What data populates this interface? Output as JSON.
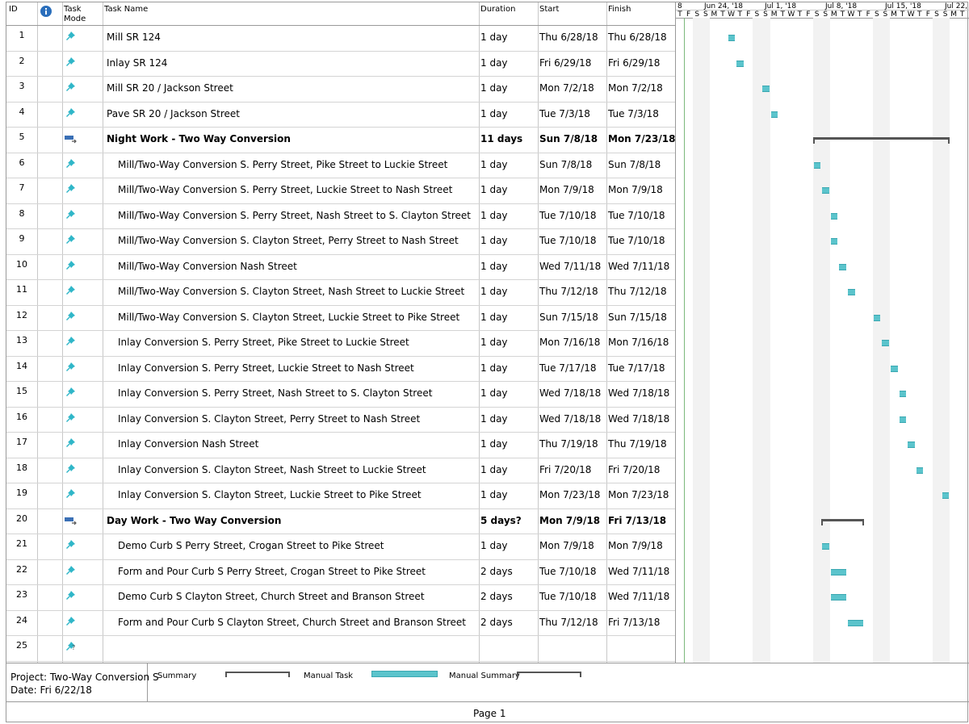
{
  "columns": {
    "id": "ID",
    "task_mode": "Task\nMode",
    "task_name": "Task Name",
    "duration": "Duration",
    "start": "Start",
    "finish": "Finish"
  },
  "timeline": {
    "weeks": [
      "8",
      "Jun 24, '18",
      "Jul 1, '18",
      "Jul 8, '18",
      "Jul 15, '18",
      "Jul 22, '18"
    ],
    "days": [
      "T",
      "F",
      "S",
      "S",
      "M",
      "T",
      "W",
      "T",
      "F",
      "S",
      "S",
      "M",
      "T",
      "W",
      "T",
      "F",
      "S",
      "S",
      "M",
      "T",
      "W",
      "T",
      "F",
      "S",
      "S",
      "M",
      "T",
      "W",
      "T",
      "F",
      "S",
      "S",
      "M",
      "T"
    ]
  },
  "tasks": [
    {
      "id": "1",
      "name": "Mill SR 124",
      "duration": "1 day",
      "start": "Thu 6/28/18",
      "finish": "Thu 6/28/18",
      "indent": 0,
      "summary": false,
      "bar_start": 6,
      "bar_len": 1
    },
    {
      "id": "2",
      "name": "Inlay SR 124",
      "duration": "1 day",
      "start": "Fri 6/29/18",
      "finish": "Fri 6/29/18",
      "indent": 0,
      "summary": false,
      "bar_start": 7,
      "bar_len": 1
    },
    {
      "id": "3",
      "name": "Mill SR 20 / Jackson Street",
      "duration": "1 day",
      "start": "Mon 7/2/18",
      "finish": "Mon 7/2/18",
      "indent": 0,
      "summary": false,
      "bar_start": 10,
      "bar_len": 1
    },
    {
      "id": "4",
      "name": "Pave SR 20 / Jackson Street",
      "duration": "1 day",
      "start": "Tue 7/3/18",
      "finish": "Tue 7/3/18",
      "indent": 0,
      "summary": false,
      "bar_start": 11,
      "bar_len": 1
    },
    {
      "id": "5",
      "name": "Night Work - Two Way Conversion",
      "duration": "11 days",
      "start": "Sun 7/8/18",
      "finish": "Mon 7/23/18",
      "indent": 0,
      "summary": true,
      "bar_start": 16,
      "bar_len": 16
    },
    {
      "id": "6",
      "name": "Mill/Two-Way Conversion S. Perry Street, Pike Street to Luckie Street",
      "duration": "1 day",
      "start": "Sun 7/8/18",
      "finish": "Sun 7/8/18",
      "indent": 1,
      "summary": false,
      "bar_start": 16,
      "bar_len": 1
    },
    {
      "id": "7",
      "name": "Mill/Two-Way Conversion S. Perry Street, Luckie Street to Nash Street",
      "duration": "1 day",
      "start": "Mon 7/9/18",
      "finish": "Mon 7/9/18",
      "indent": 1,
      "summary": false,
      "bar_start": 17,
      "bar_len": 1
    },
    {
      "id": "8",
      "name": "Mill/Two-Way Conversion S. Perry Street, Nash Street to S. Clayton Street",
      "duration": "1 day",
      "start": "Tue 7/10/18",
      "finish": "Tue 7/10/18",
      "indent": 1,
      "summary": false,
      "bar_start": 18,
      "bar_len": 1
    },
    {
      "id": "9",
      "name": "Mill/Two-Way Conversion S. Clayton Street, Perry Street to Nash Street",
      "duration": "1 day",
      "start": "Tue 7/10/18",
      "finish": "Tue 7/10/18",
      "indent": 1,
      "summary": false,
      "bar_start": 18,
      "bar_len": 1
    },
    {
      "id": "10",
      "name": "Mill/Two-Way Conversion Nash Street",
      "duration": "1 day",
      "start": "Wed 7/11/18",
      "finish": "Wed 7/11/18",
      "indent": 1,
      "summary": false,
      "bar_start": 19,
      "bar_len": 1
    },
    {
      "id": "11",
      "name": "Mill/Two-Way Conversion S. Clayton Street, Nash Street to Luckie Street",
      "duration": "1 day",
      "start": "Thu 7/12/18",
      "finish": "Thu 7/12/18",
      "indent": 1,
      "summary": false,
      "bar_start": 20,
      "bar_len": 1
    },
    {
      "id": "12",
      "name": "Mill/Two-Way Conversion S. Clayton Street, Luckie Street to Pike Street",
      "duration": "1 day",
      "start": "Sun 7/15/18",
      "finish": "Sun 7/15/18",
      "indent": 1,
      "summary": false,
      "bar_start": 23,
      "bar_len": 1
    },
    {
      "id": "13",
      "name": "Inlay Conversion S. Perry Street, Pike Street to Luckie Street",
      "duration": "1 day",
      "start": "Mon 7/16/18",
      "finish": "Mon 7/16/18",
      "indent": 1,
      "summary": false,
      "bar_start": 24,
      "bar_len": 1
    },
    {
      "id": "14",
      "name": "Inlay Conversion S. Perry Street, Luckie Street to Nash Street",
      "duration": "1 day",
      "start": "Tue 7/17/18",
      "finish": "Tue 7/17/18",
      "indent": 1,
      "summary": false,
      "bar_start": 25,
      "bar_len": 1
    },
    {
      "id": "15",
      "name": "Inlay Conversion S. Perry Street, Nash Street to S. Clayton Street",
      "duration": "1 day",
      "start": "Wed 7/18/18",
      "finish": "Wed 7/18/18",
      "indent": 1,
      "summary": false,
      "bar_start": 26,
      "bar_len": 1
    },
    {
      "id": "16",
      "name": "Inlay Conversion S. Clayton Street, Perry Street to Nash Street",
      "duration": "1 day",
      "start": "Wed 7/18/18",
      "finish": "Wed 7/18/18",
      "indent": 1,
      "summary": false,
      "bar_start": 26,
      "bar_len": 1
    },
    {
      "id": "17",
      "name": "Inlay Conversion Nash Street",
      "duration": "1 day",
      "start": "Thu 7/19/18",
      "finish": "Thu 7/19/18",
      "indent": 1,
      "summary": false,
      "bar_start": 27,
      "bar_len": 1
    },
    {
      "id": "18",
      "name": "Inlay Conversion S. Clayton Street, Nash Street to Luckie Street",
      "duration": "1 day",
      "start": "Fri 7/20/18",
      "finish": "Fri 7/20/18",
      "indent": 1,
      "summary": false,
      "bar_start": 28,
      "bar_len": 1
    },
    {
      "id": "19",
      "name": "Inlay Conversion S. Clayton Street, Luckie Street to Pike Street",
      "duration": "1 day",
      "start": "Mon 7/23/18",
      "finish": "Mon 7/23/18",
      "indent": 1,
      "summary": false,
      "bar_start": 31,
      "bar_len": 1
    },
    {
      "id": "20",
      "name": "Day Work - Two Way Conversion",
      "duration": "5 days?",
      "start": "Mon 7/9/18",
      "finish": "Fri 7/13/18",
      "indent": 0,
      "summary": true,
      "bar_start": 17,
      "bar_len": 5
    },
    {
      "id": "21",
      "name": "Demo Curb S Perry Street, Crogan Street to Pike Street",
      "duration": "1 day",
      "start": "Mon 7/9/18",
      "finish": "Mon 7/9/18",
      "indent": 1,
      "summary": false,
      "bar_start": 17,
      "bar_len": 1
    },
    {
      "id": "22",
      "name": "Form and Pour Curb S Perry Street, Crogan Street to Pike Street",
      "duration": "2 days",
      "start": "Tue 7/10/18",
      "finish": "Wed 7/11/18",
      "indent": 1,
      "summary": false,
      "bar_start": 18,
      "bar_len": 2
    },
    {
      "id": "23",
      "name": "Demo Curb S Clayton Street, Church Street and Branson Street",
      "duration": "2 days",
      "start": "Tue 7/10/18",
      "finish": "Wed 7/11/18",
      "indent": 1,
      "summary": false,
      "bar_start": 18,
      "bar_len": 2
    },
    {
      "id": "24",
      "name": "Form and Pour Curb S Clayton Street, Church Street and Branson Street",
      "duration": "2 days",
      "start": "Thu 7/12/18",
      "finish": "Fri 7/13/18",
      "indent": 1,
      "summary": false,
      "bar_start": 20,
      "bar_len": 2
    },
    {
      "id": "25",
      "name": "",
      "duration": "",
      "start": "",
      "finish": "",
      "indent": 0,
      "summary": false,
      "empty": true
    }
  ],
  "legend": {
    "project_label": "Project: Two-Way Conversion S",
    "date_label": "Date: Fri 6/22/18",
    "summary_label": "Summary",
    "manual_task_label": "Manual Task",
    "manual_summary_label": "Manual Summary"
  },
  "footer": {
    "page_label": "Page 1"
  },
  "colors": {
    "task_bar": "#5bc4cc",
    "summary_bar": "#555555",
    "pin_icon": "#2fb6c8",
    "info_icon": "#2a6ebb"
  }
}
